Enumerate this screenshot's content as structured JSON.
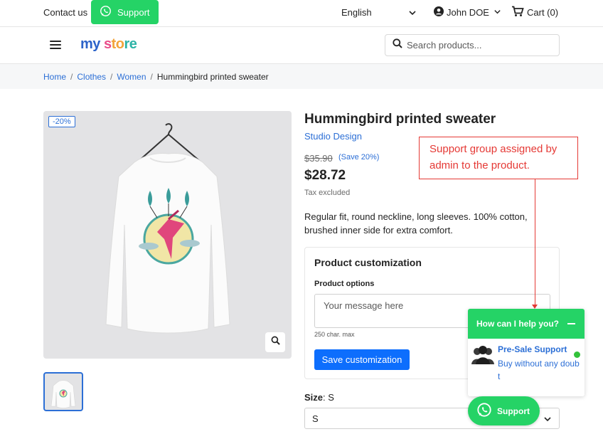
{
  "topbar": {
    "contact_label": "Contact us",
    "support_label": "Support",
    "language": "English",
    "user_name": "John DOE",
    "cart_label": "Cart (0)"
  },
  "header": {
    "logo_parts": [
      "my",
      " s",
      "to",
      "re"
    ],
    "search_placeholder": "Search products..."
  },
  "breadcrumb": [
    "Home",
    "Clothes",
    "Women",
    "Hummingbird printed sweater"
  ],
  "product": {
    "discount_badge": "-20%",
    "title": "Hummingbird printed sweater",
    "brand": "Studio Design",
    "old_price": "$35.90",
    "save_label": "(Save 20%)",
    "price": "$28.72",
    "tax_note": "Tax excluded",
    "description": "Regular fit, round neckline, long sleeves. 100% cotton, brushed inner side for extra comfort."
  },
  "customization": {
    "title": "Product customization",
    "options_label": "Product options",
    "message_placeholder": "Your message here",
    "char_max": "250 char. max",
    "save_button": "Save customization"
  },
  "size": {
    "label": "Size",
    "selected": "S",
    "option": "S"
  },
  "annotation": {
    "text": "Support group assigned by admin to the product."
  },
  "support_widget": {
    "header": "How can I help you?",
    "agent_name": "Pre-Sale Support",
    "agent_subtitle": "Buy without any doubt",
    "float_button": "Support",
    "status_color": "#33c23a"
  },
  "colors": {
    "whatsapp_green": "#25d366",
    "link_blue": "#2c6fd6",
    "primary_button": "#0d6efd",
    "annotation_red": "#e53935"
  }
}
